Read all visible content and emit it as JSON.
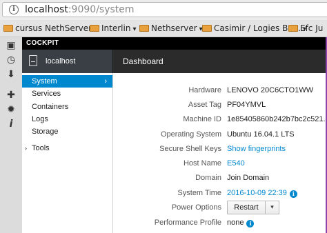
{
  "browser": {
    "url_host": "localhost",
    "url_path": ":9090/system",
    "bookmarks": [
      {
        "label": "cursus NethServer"
      },
      {
        "label": "Interlin"
      },
      {
        "label": "Nethserver"
      },
      {
        "label": "Casimir / Logies Bo..."
      },
      {
        "label": "Efc Ju"
      }
    ]
  },
  "cockpit": {
    "brand": "COCKPIT",
    "host": "localhost",
    "page_title": "Dashboard",
    "nav": [
      {
        "label": "System"
      },
      {
        "label": "Services"
      },
      {
        "label": "Containers"
      },
      {
        "label": "Logs"
      },
      {
        "label": "Storage"
      },
      {
        "label": "Tools"
      }
    ],
    "details": {
      "hardware": {
        "label": "Hardware",
        "value": "LENOVO 20C6CTO1WW"
      },
      "asset_tag": {
        "label": "Asset Tag",
        "value": "PF04YMVL"
      },
      "machine_id": {
        "label": "Machine ID",
        "value": "1e85405860b242b7bc2c521..."
      },
      "os": {
        "label": "Operating System",
        "value": "Ubuntu 16.04.1 LTS"
      },
      "ssh": {
        "label": "Secure Shell Keys",
        "value": "Show fingerprints"
      },
      "hostname": {
        "label": "Host Name",
        "value": "E540"
      },
      "domain": {
        "label": "Domain",
        "value": "Join Domain"
      },
      "time": {
        "label": "System Time",
        "value": "2016-10-09 22:39"
      },
      "power": {
        "label": "Power Options",
        "button": "Restart"
      },
      "profile": {
        "label": "Performance Profile",
        "value": "none"
      }
    }
  },
  "colors": {
    "accent": "#0088ce",
    "brand_bar": "#000000",
    "host_bar": "#2b2b2b"
  }
}
